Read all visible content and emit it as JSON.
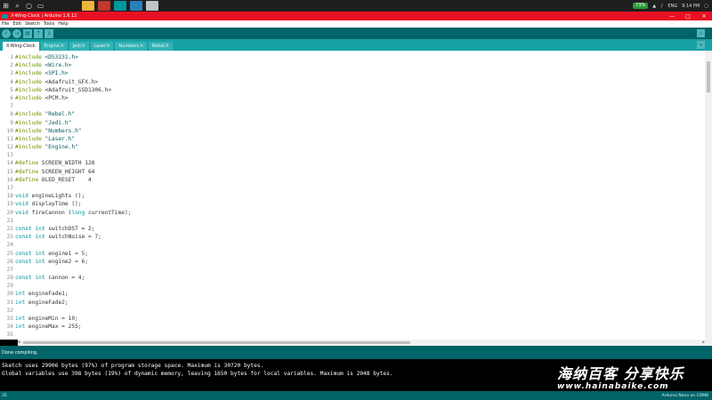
{
  "taskbar": {
    "icons": [
      {
        "name": "windows-start-icon",
        "glyph": "⊞"
      },
      {
        "name": "search-icon",
        "glyph": "⌕"
      },
      {
        "name": "task-view-icon",
        "glyph": "○"
      },
      {
        "name": "multitask-icon",
        "glyph": "▭"
      }
    ],
    "apps": [
      {
        "name": "file-explorer-app",
        "color": "#f0b43a"
      },
      {
        "name": "media-app",
        "color": "#c0392b"
      },
      {
        "name": "arduino-app",
        "color": "#00979d"
      },
      {
        "name": "browser-app",
        "color": "#2980b9"
      },
      {
        "name": "notes-app",
        "color": "#bdc3c7"
      }
    ],
    "badge": "73%",
    "language": "ENG",
    "time": "9:14 PM"
  },
  "window": {
    "title": "X-Wing-Clock | Arduino 1.6.12",
    "controls": {
      "minimize": "—",
      "maximize": "□",
      "close": "✕"
    }
  },
  "menu": [
    "File",
    "Edit",
    "Sketch",
    "Tools",
    "Help"
  ],
  "toolbar": {
    "verify": "✓",
    "upload": "→",
    "new": "▤",
    "open": "↑",
    "save": "↓",
    "serial": "⌕"
  },
  "tabs": [
    "X-Wing-Clock",
    "Engine.h",
    "Jedi.h",
    "Laser.h",
    "Numbers.h",
    "Rebel.h"
  ],
  "tab_menu": "▾",
  "code": [
    {
      "n": "1",
      "s": [
        [
          "kw",
          "#include"
        ],
        [
          "txt",
          " "
        ],
        [
          "st",
          "<DS3231.h>"
        ]
      ]
    },
    {
      "n": "2",
      "s": [
        [
          "kw",
          "#include"
        ],
        [
          "txt",
          " "
        ],
        [
          "st",
          "<Wire.h>"
        ]
      ]
    },
    {
      "n": "3",
      "s": [
        [
          "kw",
          "#include"
        ],
        [
          "txt",
          " "
        ],
        [
          "st",
          "<SPI.h>"
        ]
      ]
    },
    {
      "n": "4",
      "s": [
        [
          "kw",
          "#include"
        ],
        [
          "txt",
          " <Adafruit_GFX.h>"
        ]
      ]
    },
    {
      "n": "5",
      "s": [
        [
          "kw",
          "#include"
        ],
        [
          "txt",
          " <Adafruit_SSD1306.h>"
        ]
      ]
    },
    {
      "n": "6",
      "s": [
        [
          "kw",
          "#include"
        ],
        [
          "txt",
          " <PCM.h>"
        ]
      ]
    },
    {
      "n": "7",
      "s": []
    },
    {
      "n": "8",
      "s": [
        [
          "kw",
          "#include"
        ],
        [
          "txt",
          " "
        ],
        [
          "st",
          "\"Rebel.h\""
        ]
      ]
    },
    {
      "n": "9",
      "s": [
        [
          "kw",
          "#include"
        ],
        [
          "txt",
          " "
        ],
        [
          "st",
          "\"Jedi.h\""
        ]
      ]
    },
    {
      "n": "10",
      "s": [
        [
          "kw",
          "#include"
        ],
        [
          "txt",
          " "
        ],
        [
          "st",
          "\"Numbers.h\""
        ]
      ]
    },
    {
      "n": "11",
      "s": [
        [
          "kw",
          "#include"
        ],
        [
          "txt",
          " "
        ],
        [
          "st",
          "\"Laser.h\""
        ]
      ]
    },
    {
      "n": "12",
      "s": [
        [
          "kw",
          "#include"
        ],
        [
          "txt",
          " "
        ],
        [
          "st",
          "\"Engine.h\""
        ]
      ]
    },
    {
      "n": "13",
      "s": []
    },
    {
      "n": "14",
      "s": [
        [
          "kw",
          "#define"
        ],
        [
          "txt",
          " SCREEN_WIDTH 128"
        ]
      ]
    },
    {
      "n": "15",
      "s": [
        [
          "kw",
          "#define"
        ],
        [
          "txt",
          " SCREEN_HEIGHT 64"
        ]
      ]
    },
    {
      "n": "16",
      "s": [
        [
          "kw",
          "#define"
        ],
        [
          "txt",
          " OLED_RESET    4"
        ]
      ]
    },
    {
      "n": "17",
      "s": []
    },
    {
      "n": "18",
      "s": [
        [
          "ty",
          "void"
        ],
        [
          "txt",
          " engineLights ();"
        ]
      ]
    },
    {
      "n": "19",
      "s": [
        [
          "ty",
          "void"
        ],
        [
          "txt",
          " displayTime ();"
        ]
      ]
    },
    {
      "n": "20",
      "s": [
        [
          "ty",
          "void"
        ],
        [
          "txt",
          " fireCannon ("
        ],
        [
          "ty",
          "long"
        ],
        [
          "txt",
          " currentTime);"
        ]
      ]
    },
    {
      "n": "21",
      "s": []
    },
    {
      "n": "22",
      "s": [
        [
          "ty",
          "const"
        ],
        [
          "txt",
          " "
        ],
        [
          "ty",
          "int"
        ],
        [
          "txt",
          " switchDST = 2;"
        ]
      ]
    },
    {
      "n": "23",
      "s": [
        [
          "ty",
          "const"
        ],
        [
          "txt",
          " "
        ],
        [
          "ty",
          "int"
        ],
        [
          "txt",
          " switchNoise = 7;"
        ]
      ]
    },
    {
      "n": "24",
      "s": []
    },
    {
      "n": "25",
      "s": [
        [
          "ty",
          "const"
        ],
        [
          "txt",
          " "
        ],
        [
          "ty",
          "int"
        ],
        [
          "txt",
          " engine1 = 5;"
        ]
      ]
    },
    {
      "n": "26",
      "s": [
        [
          "ty",
          "const"
        ],
        [
          "txt",
          " "
        ],
        [
          "ty",
          "int"
        ],
        [
          "txt",
          " engine2 = 6;"
        ]
      ]
    },
    {
      "n": "27",
      "s": []
    },
    {
      "n": "28",
      "s": [
        [
          "ty",
          "const"
        ],
        [
          "txt",
          " "
        ],
        [
          "ty",
          "int"
        ],
        [
          "txt",
          " cannon = 4;"
        ]
      ]
    },
    {
      "n": "29",
      "s": []
    },
    {
      "n": "30",
      "s": [
        [
          "ty",
          "int"
        ],
        [
          "txt",
          " engineFade1;"
        ]
      ]
    },
    {
      "n": "31",
      "s": [
        [
          "ty",
          "int"
        ],
        [
          "txt",
          " engineFade2;"
        ]
      ]
    },
    {
      "n": "32",
      "s": []
    },
    {
      "n": "33",
      "s": [
        [
          "ty",
          "int"
        ],
        [
          "txt",
          " engineMin = 10;"
        ]
      ]
    },
    {
      "n": "34",
      "s": [
        [
          "ty",
          "int"
        ],
        [
          "txt",
          " engineMax = 255;"
        ]
      ]
    },
    {
      "n": "35",
      "s": []
    }
  ],
  "status": "Done compiling.",
  "console": [
    "Sketch uses 29906 bytes (97%) of program storage space. Maximum is 30720 bytes.",
    "Global variables use 398 bytes (19%) of dynamic memory, leaving 1650 bytes for local variables. Maximum is 2048 bytes."
  ],
  "watermark": {
    "cn": "海纳百客 分享快乐",
    "url": "www.hainabaike.com"
  },
  "bottom": {
    "line": "35",
    "board": "Arduino Nano on COM8"
  },
  "colors": {
    "teal_dark": "#006468",
    "teal": "#17a1a5",
    "title_red": "#e81123"
  }
}
